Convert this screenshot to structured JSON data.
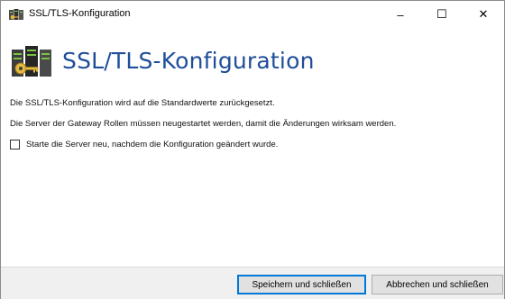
{
  "window": {
    "title": "SSL/TLS-Konfiguration",
    "controls": {
      "minimize": "–",
      "maximize": "☐",
      "close": "✕"
    }
  },
  "header": {
    "title": "SSL/TLS-Konfiguration",
    "icon": "servers-with-key-icon"
  },
  "body": {
    "line1": "Die SSL/TLS-Konfiguration wird auf die Standardwerte zurückgesetzt.",
    "line2": "Die Server der Gateway Rollen müssen neugestartet werden, damit die Änderungen wirksam werden.",
    "restart_checkbox": {
      "label": "Starte die Server neu, nachdem die Konfiguration geändert wurde.",
      "checked": false
    }
  },
  "footer": {
    "save_label": "Speichern und schließen",
    "cancel_label": "Abbrechen und schließen"
  },
  "colors": {
    "title_blue": "#1f4e9a",
    "footer_bg": "#f0f0f0",
    "default_button_border": "#0078d7"
  }
}
